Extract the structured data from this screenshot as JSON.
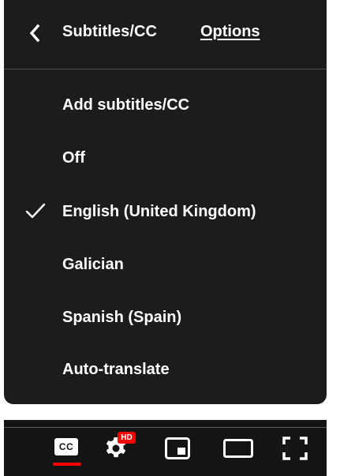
{
  "header": {
    "title": "Subtitles/CC",
    "options_label": "Options"
  },
  "items": [
    {
      "label": "Add subtitles/CC",
      "selected": false
    },
    {
      "label": "Off",
      "selected": false
    },
    {
      "label": "English (United Kingdom)",
      "selected": true
    },
    {
      "label": "Galician",
      "selected": false
    },
    {
      "label": "Spanish (Spain)",
      "selected": false
    },
    {
      "label": "Auto-translate",
      "selected": false
    }
  ],
  "controls": {
    "cc_label": "CC",
    "hd_badge": "HD",
    "icons": [
      "subtitles-icon",
      "settings-icon",
      "miniplayer-icon",
      "theater-mode-icon",
      "fullscreen-icon"
    ]
  },
  "colors": {
    "menu_bg": "#1c1c1c",
    "bar_bg": "#141414",
    "accent": "#ff0000",
    "text": "#ffffff"
  }
}
